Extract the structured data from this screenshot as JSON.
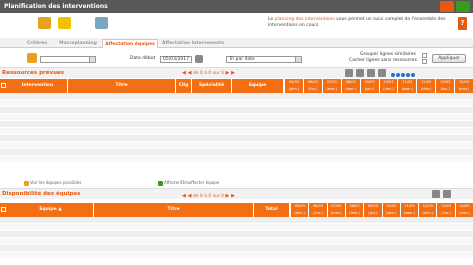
{
  "window": {
    "title": "Planification des interventions"
  },
  "toolbar": {
    "info_highlight": "planning des interventions",
    "info_prefix": "Le ",
    "info_suffix": " vous permet un suivi complet de l'ensemble des interventions en cours"
  },
  "tabs": [
    {
      "label": "Critères",
      "active": false
    },
    {
      "label": "Macroplanning",
      "active": false
    },
    {
      "label": "Affectation équipes",
      "active": true
    },
    {
      "label": "Affectation intervenants",
      "active": false
    }
  ],
  "filter": {
    "date_label": "Date début",
    "date_value": "05/03/2017",
    "sort_value": "Tri par date",
    "group_label": "Grouper lignes similaires",
    "hide_label": "Cacher lignes sans ressources",
    "apply_label": "Appliquer"
  },
  "section1": {
    "title": "Ressources prévues",
    "pager": "de 0 à 0 sur 0",
    "columns": [
      "Intervention",
      "Titre",
      "Clig",
      "Spécialité",
      "Equipe"
    ],
    "days": [
      {
        "d": "05/03",
        "w": "(dim.)"
      },
      {
        "d": "06/03",
        "w": "(lun.)"
      },
      {
        "d": "07/03",
        "w": "(mar.)"
      },
      {
        "d": "08/03",
        "w": "(mer.)"
      },
      {
        "d": "09/03",
        "w": "(jeu.)"
      },
      {
        "d": "10/03",
        "w": "(ven.)"
      },
      {
        "d": "11/03",
        "w": "(sam.)"
      },
      {
        "d": "12/03",
        "w": "(dim.)"
      },
      {
        "d": "13/03",
        "w": "(lun.)"
      },
      {
        "d": "14/03",
        "w": "(mar.)"
      }
    ]
  },
  "links": {
    "left": "Voir les équipes possibles",
    "right": "Affecter/Désaffecter équipe"
  },
  "section2": {
    "title": "Disponibilité des équipes",
    "pager": "de 0 à 0 sur 0",
    "columns": [
      "Equipe",
      "Titre",
      "Total"
    ],
    "days": [
      {
        "d": "05/03",
        "w": "(dim.)"
      },
      {
        "d": "06/03",
        "w": "(lun.)"
      },
      {
        "d": "07/03",
        "w": "(mar.)"
      },
      {
        "d": "08/03",
        "w": "(mer.)"
      },
      {
        "d": "09/03",
        "w": "(jeu.)"
      },
      {
        "d": "10/03",
        "w": "(ven.)"
      },
      {
        "d": "11/03",
        "w": "(sam.)"
      },
      {
        "d": "12/03",
        "w": "(dim.)"
      },
      {
        "d": "13/03",
        "w": "(lun.)"
      },
      {
        "d": "14/03",
        "w": "(mar.)"
      }
    ]
  }
}
